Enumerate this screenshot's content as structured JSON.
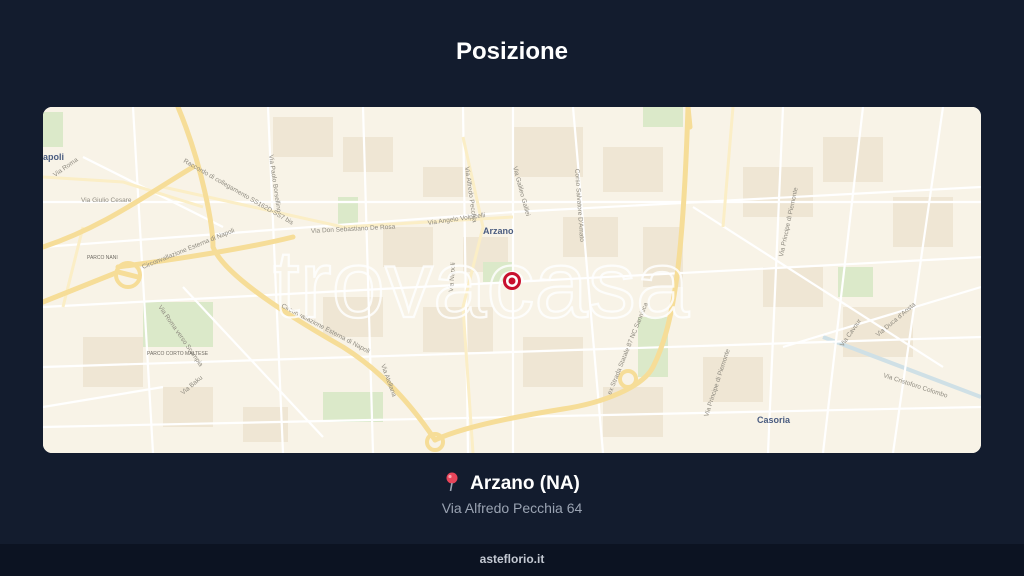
{
  "page": {
    "title": "Posizione"
  },
  "map": {
    "watermark": "trovacasa",
    "places": [
      {
        "id": "arzano",
        "label": "Arzano"
      },
      {
        "id": "casoria",
        "label": "Casoria"
      },
      {
        "id": "napoli",
        "label": "apoli"
      },
      {
        "id": "parco-nani",
        "label": "PARCO NANI"
      },
      {
        "id": "parco-corto",
        "label": "PARCO CORTO MALTESE"
      }
    ],
    "streets": [
      "Via Alfredo Pecchia",
      "Via Napoli",
      "Via Don Sebastiano De Rosa",
      "Via Angelo Volpicelli",
      "Circonvallazione Esterna di Napoli",
      "Raccordo di collegamento SS162D-SS7 bis",
      "Via Paolo Borsellino",
      "Via Giulio Cesare",
      "Via Roma verso Scampia",
      "Via Baku",
      "Via Atellana",
      "Via Roma",
      "Corso Salvatore D'Amato",
      "ex Strada Statale 87 NC Sannitica",
      "Via Principe di Piemonte",
      "Via Cavour",
      "Via Cristoforo Colombo",
      "Via Duca d'Aosta",
      "Via Antonio Gigli",
      "Via Galileo Galilei"
    ]
  },
  "location": {
    "pin_icon": "round-pushpin-icon",
    "city": "Arzano (NA)",
    "address": "Via Alfredo Pecchia 64"
  },
  "footer": {
    "site": "asteflorio.it"
  },
  "colors": {
    "background": "#131c2e",
    "map_land": "#f8f3e7",
    "major_road": "#f6dd98",
    "pin": "#c8102e"
  }
}
